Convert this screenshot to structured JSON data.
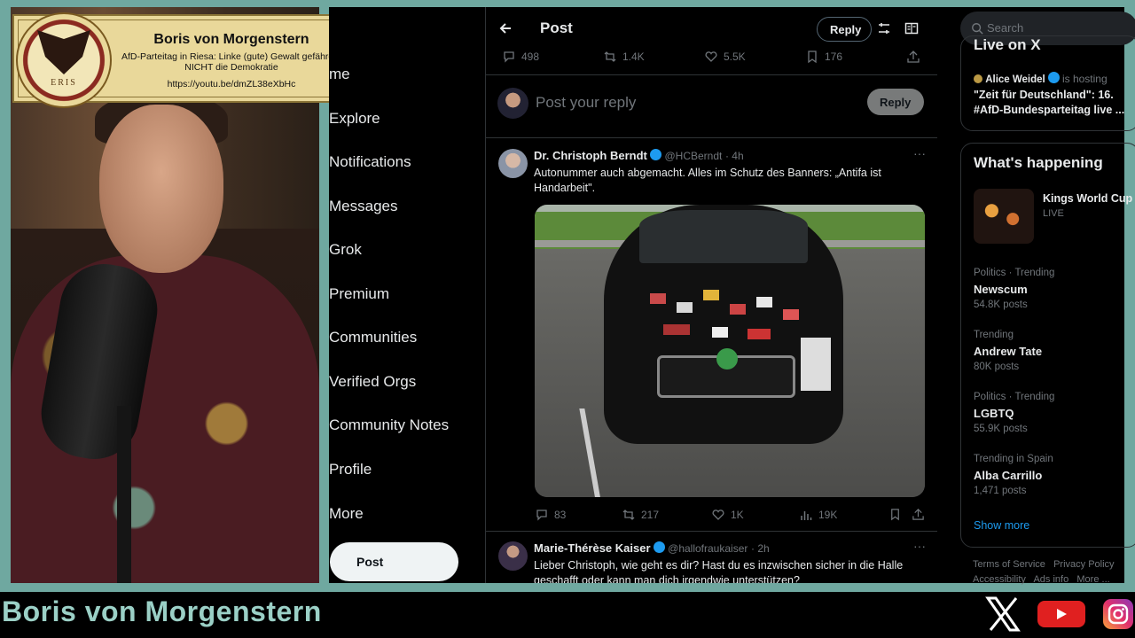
{
  "overlay": {
    "card_name": "Boris von Morgenstern",
    "card_subtitle": "AfD-Parteitag in Riesa: Linke (gute) Gewalt gefährdet NICHT die Demokratie",
    "card_url": "https://youtu.be/dmZL38eXbHc",
    "logo_text": "ERIS",
    "channel_name": "Boris von Morgenstern"
  },
  "nav": {
    "items": [
      "me",
      "Explore",
      "Notifications",
      "Messages",
      "Grok",
      "Premium",
      "Communities",
      "Verified Orgs",
      "Community Notes",
      "Profile",
      "More"
    ],
    "post_button": "Post"
  },
  "header": {
    "title": "Post",
    "reply_button": "Reply"
  },
  "post_stats": {
    "replies": "498",
    "reposts": "1.4K",
    "likes": "5.5K",
    "bookmarks": "176"
  },
  "compose": {
    "placeholder": "Post your reply",
    "button": "Reply"
  },
  "tweet1": {
    "name": "Dr. Christoph Berndt",
    "handle": "@HCBerndt",
    "time": "· 4h",
    "text": "Autonummer auch abgemacht. Alles im Schutz des Banners: „Antifa ist Handarbeit\".",
    "replies": "83",
    "reposts": "217",
    "likes": "1K",
    "views": "19K"
  },
  "tweet2": {
    "name": "Marie-Thérèse Kaiser",
    "handle": "@hallofraukaiser",
    "time": "· 2h",
    "text": "Lieber Christoph, wie geht es dir? Hast du es inzwischen sicher in die Halle geschafft oder kann man dich irgendwie unterstützen?"
  },
  "sidebar": {
    "search_placeholder": "Search",
    "live_label": "Live on X",
    "live_host": "Alice Weidel",
    "live_hosting": "is hosting",
    "live_title": "\"Zeit für Deutschland\": 16. #AfD-Bundesparteitag live ...",
    "whats_happening": "What's happening",
    "featured": {
      "name": "Kings World Cup",
      "status": "LIVE"
    },
    "trends": [
      {
        "category": "Politics · Trending",
        "name": "Newscum",
        "count": "54.8K posts"
      },
      {
        "category": "Trending",
        "name": "Andrew Tate",
        "count": "80K posts"
      },
      {
        "category": "Politics · Trending",
        "name": "LGBTQ",
        "count": "55.9K posts"
      },
      {
        "category": "Trending in Spain",
        "name": "Alba Carrillo",
        "count": "1,471 posts"
      }
    ],
    "show_more": "Show more",
    "footer": {
      "tos": "Terms of Service",
      "privacy": "Privacy Policy",
      "accessibility": "Accessibility",
      "ads": "Ads info",
      "more": "More ..."
    }
  },
  "colors": {
    "accent": "#1d9bf0",
    "frame": "#6fa8a0",
    "channel_text": "#9bd0c6",
    "card_bg": "#e9d89a"
  },
  "icons": [
    "back-arrow-icon",
    "settings-icon",
    "reader-icon",
    "reply-icon",
    "repost-icon",
    "heart-icon",
    "bookmark-icon",
    "share-icon",
    "more-icon",
    "views-icon",
    "search-icon",
    "x-logo-icon",
    "youtube-icon",
    "instagram-icon"
  ]
}
